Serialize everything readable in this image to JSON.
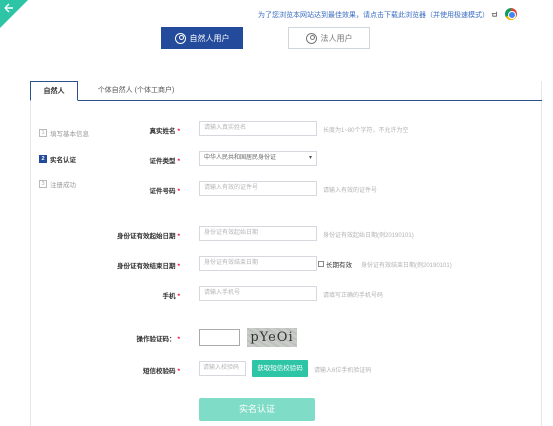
{
  "notice": {
    "text": "为了您浏览本网站达到最佳效果，请点击下载此浏览器（并使用极速模式）"
  },
  "user_types": {
    "natural": "自然人用户",
    "legal": "法人用户"
  },
  "tabs": [
    {
      "label": "自然人"
    },
    {
      "label": "个体自然人 (个体工商户)"
    }
  ],
  "steps": [
    {
      "num": "1",
      "label": "填写基本信息"
    },
    {
      "num": "2",
      "label": "实名认证"
    },
    {
      "num": "3",
      "label": "注册成功"
    }
  ],
  "form": {
    "real_name": {
      "label": "真实姓名",
      "placeholder": "请输入真实姓名",
      "hint": "长度为1~80个字符，不允许为空"
    },
    "id_type": {
      "label": "证件类型",
      "value": "中华人民共和国居民身份证"
    },
    "id_number": {
      "label": "证件号码",
      "placeholder": "请输入有效的证件号",
      "hint": "请输入有效的证件号"
    },
    "id_start": {
      "label": "身份证有效起始日期",
      "placeholder": "身份证有效起始日期",
      "hint": "身份证有效起始日期(例20190101)"
    },
    "id_end": {
      "label": "身份证有效结束日期",
      "placeholder": "身份证有效结束日期",
      "long_term": "长期有效",
      "hint": "身份证有效结束日期(例20190101)"
    },
    "phone": {
      "label": "手机",
      "placeholder": "请输入手机号",
      "hint": "请填写正确的手机号码"
    },
    "captcha": {
      "label": "操作验证码：",
      "image_text": "pYeOi"
    },
    "sms": {
      "label": "短信校验码",
      "placeholder": "请输入校验码",
      "button": "获取短信校验码",
      "hint": "请输入6位手机验证码"
    },
    "submit": "实名认证"
  },
  "colors": {
    "primary": "#244a9b",
    "accent": "#2ec4a6",
    "required": "#e03"
  }
}
